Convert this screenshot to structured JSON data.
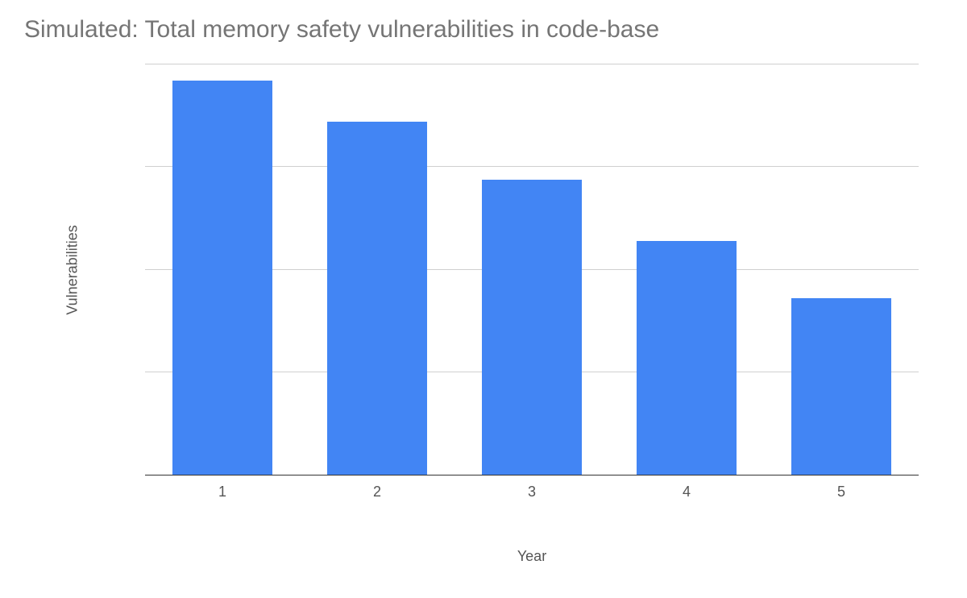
{
  "chart_data": {
    "type": "bar",
    "title": "Simulated: Total memory safety vulnerabilities in code-base",
    "xlabel": "Year",
    "ylabel": "Vulnerabilities",
    "categories": [
      "1",
      "2",
      "3",
      "4",
      "5"
    ],
    "values": [
      96,
      86,
      72,
      57,
      43
    ],
    "ylim": [
      0,
      100
    ],
    "gridlines_y": [
      25,
      50,
      75,
      100
    ],
    "bar_color": "#4285f4"
  }
}
